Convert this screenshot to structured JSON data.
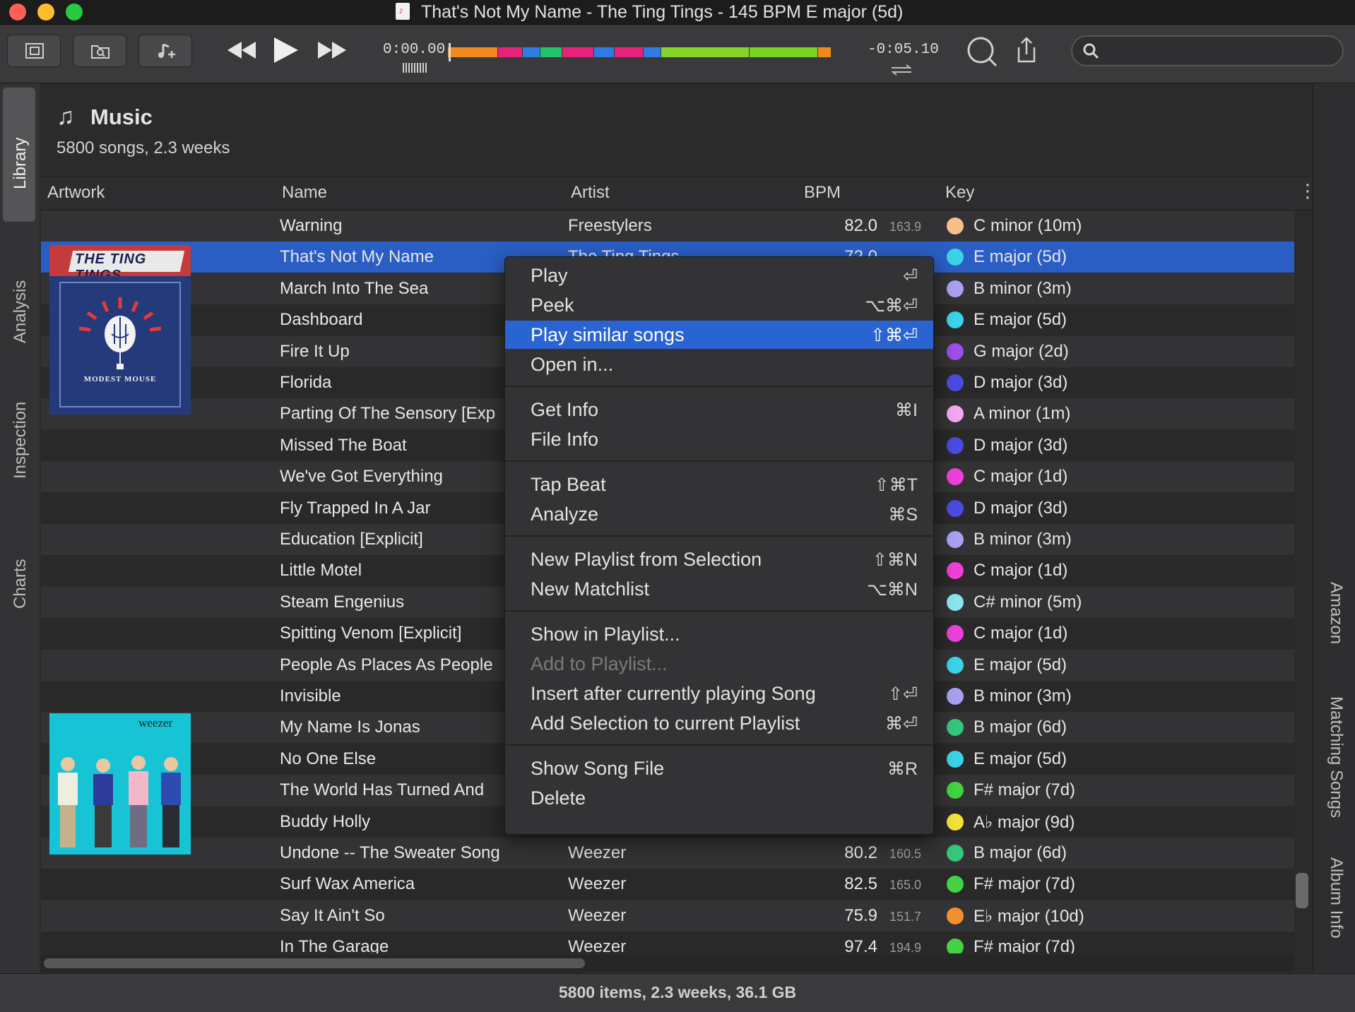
{
  "window": {
    "title": "That's Not My Name - The Ting Tings - 145 BPM E major (5d)"
  },
  "player": {
    "time_elapsed": "0:00.00",
    "time_remaining": "-0:05.10",
    "waveform_colors": [
      "#f08a1c",
      "#e8227a",
      "#2f7de2",
      "#20c46a",
      "#e8227a",
      "#2f7de2",
      "#e8227a",
      "#2f7de2",
      "#86d428",
      "#76d41e",
      "#f08a1c"
    ],
    "search": {
      "placeholder": ""
    }
  },
  "left_tabs": [
    "Library",
    "Analysis",
    "Inspection",
    "Charts"
  ],
  "right_tabs": [
    "Amazon",
    "Matching Songs",
    "Album Info"
  ],
  "library": {
    "title": "Music",
    "subtitle": "5800 songs, 2.3 weeks"
  },
  "columns": {
    "artwork": "Artwork",
    "name": "Name",
    "artist": "Artist",
    "bpm": "BPM",
    "key": "Key"
  },
  "artwork": {
    "album1": {
      "banner": "THE TING TINGS",
      "label": "MODEST MOUSE"
    },
    "album2": {
      "label": "weezer"
    }
  },
  "rows": [
    {
      "name": "Warning",
      "artist": "Freestylers",
      "bpm": "82.0",
      "bpm2": "163.9",
      "key": "C minor (10m)",
      "key_color": "#f7c08a"
    },
    {
      "name": "That's Not My Name",
      "artist": "The Ting Tings",
      "bpm": "72.0",
      "bpm2": "",
      "key": "E major (5d)",
      "key_color": "#3bd3e8",
      "selected": true
    },
    {
      "name": "March Into The Sea",
      "artist": "",
      "bpm": "",
      "bpm2": "",
      "key": "B minor (3m)",
      "key_color": "#a9a0f2"
    },
    {
      "name": "Dashboard",
      "artist": "",
      "bpm": "",
      "bpm2": "",
      "key": "E major (5d)",
      "key_color": "#3bd3e8"
    },
    {
      "name": "Fire It Up",
      "artist": "",
      "bpm": "",
      "bpm2": "",
      "key": "G major (2d)",
      "key_color": "#9d4fe6"
    },
    {
      "name": "Florida",
      "artist": "",
      "bpm": "",
      "bpm2": "",
      "key": "D major (3d)",
      "key_color": "#4a4be0"
    },
    {
      "name": "Parting Of The Sensory [Exp",
      "artist": "",
      "bpm": "",
      "bpm2": "",
      "key": "A minor (1m)",
      "key_color": "#f3a7f0"
    },
    {
      "name": "Missed The Boat",
      "artist": "",
      "bpm": "",
      "bpm2": "",
      "key": "D major (3d)",
      "key_color": "#4a4be0"
    },
    {
      "name": "We've Got Everything",
      "artist": "",
      "bpm": "",
      "bpm2": "",
      "key": "C major (1d)",
      "key_color": "#ee40d8"
    },
    {
      "name": "Fly Trapped In A Jar",
      "artist": "",
      "bpm": "",
      "bpm2": "",
      "key": "D major (3d)",
      "key_color": "#4a4be0"
    },
    {
      "name": "Education [Explicit]",
      "artist": "",
      "bpm": "",
      "bpm2": "",
      "key": "B minor (3m)",
      "key_color": "#a9a0f2"
    },
    {
      "name": "Little Motel",
      "artist": "",
      "bpm": "",
      "bpm2": "",
      "key": "C major (1d)",
      "key_color": "#ee40d8"
    },
    {
      "name": "Steam Engenius",
      "artist": "",
      "bpm": "",
      "bpm2": "",
      "key": "C# minor (5m)",
      "key_color": "#8ae6ee"
    },
    {
      "name": "Spitting Venom  [Explicit]",
      "artist": "",
      "bpm": "",
      "bpm2": "",
      "key": "C major (1d)",
      "key_color": "#ee40d8"
    },
    {
      "name": "People As Places As People",
      "artist": "",
      "bpm": "",
      "bpm2": "",
      "key": "E major (5d)",
      "key_color": "#3bd3e8"
    },
    {
      "name": "Invisible",
      "artist": "",
      "bpm": "",
      "bpm2": "",
      "key": "B minor (3m)",
      "key_color": "#a9a0f2"
    },
    {
      "name": "My Name Is Jonas",
      "artist": "",
      "bpm": "",
      "bpm2": "",
      "key": "B major (6d)",
      "key_color": "#34c77c"
    },
    {
      "name": "No One Else",
      "artist": "",
      "bpm": "",
      "bpm2": "",
      "key": "E major (5d)",
      "key_color": "#3bd3e8"
    },
    {
      "name": "The World Has Turned And",
      "artist": "",
      "bpm": "",
      "bpm2": "",
      "key": "F# major (7d)",
      "key_color": "#42d242"
    },
    {
      "name": "Buddy Holly",
      "artist": "",
      "bpm": "",
      "bpm2": "",
      "key": "A♭ major (9d)",
      "key_color": "#f1e23a"
    },
    {
      "name": "Undone -- The Sweater Song",
      "artist": "Weezer",
      "bpm": "80.2",
      "bpm2": "160.5",
      "key": "B major (6d)",
      "key_color": "#34c77c"
    },
    {
      "name": "Surf Wax America",
      "artist": "Weezer",
      "bpm": "82.5",
      "bpm2": "165.0",
      "key": "F# major (7d)",
      "key_color": "#42d242"
    },
    {
      "name": "Say It Ain't So",
      "artist": "Weezer",
      "bpm": "75.9",
      "bpm2": "151.7",
      "key": "E♭ major (10d)",
      "key_color": "#f0902e"
    },
    {
      "name": "In The Garage",
      "artist": "Weezer",
      "bpm": "97.4",
      "bpm2": "194.9",
      "key": "F# major (7d)",
      "key_color": "#42d242"
    }
  ],
  "context_menu": {
    "items": [
      {
        "label": "Play",
        "shortcut": "⏎"
      },
      {
        "label": "Peek",
        "shortcut": "⌥⌘⏎"
      },
      {
        "label": "Play similar songs",
        "shortcut": "⇧⌘⏎",
        "highlighted": true
      },
      {
        "label": "Open in...",
        "shortcut": ""
      },
      {
        "label": "Get Info",
        "shortcut": "⌘I"
      },
      {
        "label": "File Info",
        "shortcut": ""
      },
      {
        "label": "Tap Beat",
        "shortcut": "⇧⌘T"
      },
      {
        "label": "Analyze",
        "shortcut": "⌘S"
      },
      {
        "label": "New Playlist from Selection",
        "shortcut": "⇧⌘N"
      },
      {
        "label": "New Matchlist",
        "shortcut": "⌥⌘N"
      },
      {
        "label": "Show in Playlist...",
        "shortcut": ""
      },
      {
        "label": "Add to Playlist...",
        "shortcut": "",
        "disabled": true
      },
      {
        "label": "Insert after currently playing Song",
        "shortcut": "⇧⏎"
      },
      {
        "label": "Add Selection to current Playlist",
        "shortcut": "⌘⏎"
      },
      {
        "label": "Show Song File",
        "shortcut": "⌘R"
      },
      {
        "label": "Delete",
        "shortcut": ""
      }
    ]
  },
  "status": {
    "text": "5800 items, 2.3 weeks, 36.1 GB"
  }
}
